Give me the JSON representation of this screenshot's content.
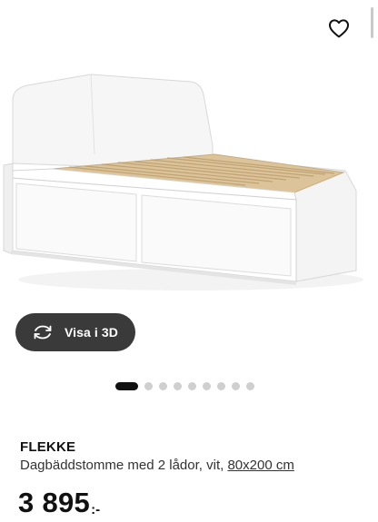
{
  "gallery": {
    "favorite_icon": "heart-outline-icon",
    "view3d": {
      "icon": "rotate-3d-icon",
      "label": "Visa i 3D"
    },
    "pagination": {
      "total": 9,
      "active": 1
    }
  },
  "product": {
    "name": "FLEKKE",
    "description": "Dagbäddstomme med 2 lådor, vit,",
    "size": "80x200 cm",
    "price": "3 895",
    "price_suffix": ":-"
  }
}
